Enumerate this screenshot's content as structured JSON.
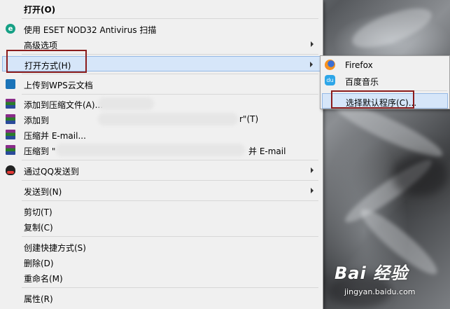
{
  "context_menu": {
    "items": [
      {
        "label": "打开(O)",
        "icon": "none",
        "bold": true
      },
      {
        "label": "使用 ESET NOD32 Antivirus 扫描",
        "icon": "eset-icon"
      },
      {
        "label": "高级选项",
        "icon": "none",
        "submenu": true
      },
      {
        "label": "打开方式(H)",
        "icon": "none",
        "submenu": true,
        "highlighted": true
      },
      {
        "label": "上传到WPS云文档",
        "icon": "wps-cloud-icon"
      },
      {
        "label": "添加到压缩文件(A)...",
        "icon": "winrar-icon"
      },
      {
        "label": "添加到",
        "suffix": "r\"(T)",
        "icon": "winrar-icon"
      },
      {
        "label": "压缩并 E-mail...",
        "icon": "winrar-icon"
      },
      {
        "label": "压缩到 \"",
        "suffix": "并 E-mail",
        "icon": "winrar-icon"
      },
      {
        "label": "通过QQ发送到",
        "icon": "qq-icon",
        "submenu": true
      },
      {
        "label": "发送到(N)",
        "icon": "none",
        "submenu": true
      },
      {
        "label": "剪切(T)",
        "icon": "none"
      },
      {
        "label": "复制(C)",
        "icon": "none"
      },
      {
        "label": "创建快捷方式(S)",
        "icon": "none"
      },
      {
        "label": "删除(D)",
        "icon": "none"
      },
      {
        "label": "重命名(M)",
        "icon": "none"
      },
      {
        "label": "属性(R)",
        "icon": "none"
      }
    ]
  },
  "open_with_submenu": {
    "items": [
      {
        "label": "Firefox",
        "icon": "firefox-icon"
      },
      {
        "label": "百度音乐",
        "icon": "baidu-music-icon"
      },
      {
        "label": "选择默认程序(C)...",
        "icon": "none",
        "highlighted": true
      }
    ]
  },
  "watermark": {
    "text": "Bai 经验",
    "url": "jingyan.baidu.com"
  },
  "colors": {
    "highlight_bg": "#d6e6f9",
    "highlight_border": "#95b9e6",
    "annotation": "#8b1c1c",
    "menu_bg": "#f0f0f0"
  }
}
